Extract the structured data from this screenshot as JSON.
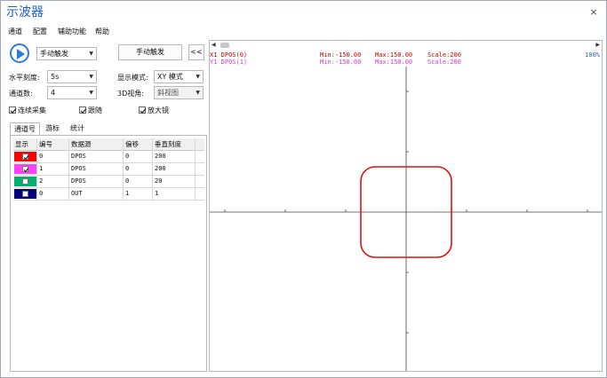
{
  "window": {
    "title": "示波器",
    "close_glyph": "×"
  },
  "menu": {
    "items": [
      "通道",
      "配置",
      "辅助功能",
      "帮助"
    ]
  },
  "controls": {
    "trigger_mode": "手动触发",
    "manual_trigger_button": "手动触发",
    "collapse_button": "<<",
    "horizontal_scale_label": "水平刻度:",
    "horizontal_scale_value": "5s",
    "display_mode_label": "显示模式:",
    "display_mode_value": "XY 模式",
    "channel_count_label": "通道数:",
    "channel_count_value": "4",
    "view_3d_label": "3D视角:",
    "view_3d_value": "斜视图",
    "continuous_label": "连续采集",
    "follow_label": "跟随",
    "magnifier_label": "放大镜"
  },
  "tabs": [
    "通道号",
    "游标",
    "统计"
  ],
  "channel_table": {
    "headers": [
      "显示",
      "编号",
      "数据源",
      "偏移",
      "垂直刻度"
    ],
    "rows": [
      {
        "color": "#ff0000",
        "checked": true,
        "id": "0",
        "source": "DPOS",
        "offset": "0",
        "scale": "200"
      },
      {
        "color": "#ff40ff",
        "checked": true,
        "id": "1",
        "source": "DPOS",
        "offset": "0",
        "scale": "200"
      },
      {
        "color": "#00b070",
        "checked": false,
        "id": "2",
        "source": "DPOS",
        "offset": "0",
        "scale": "20"
      },
      {
        "color": "#000080",
        "checked": false,
        "id": "0",
        "source": "OUT",
        "offset": "1",
        "scale": "1"
      }
    ]
  },
  "scope": {
    "x_info": {
      "name": "X1 DPOS(0)",
      "min": "Min:-150.00",
      "max": "Max:150.00",
      "scale": "Scale:200",
      "color": "#cc0000"
    },
    "y_info": {
      "name": "Y1 DPOS(1)",
      "min": "Min:-150.00",
      "max": "Max:150.00",
      "scale": "Scale:200",
      "color": "#dd33dd"
    },
    "zoom": "100%",
    "zoom_color": "#1f5fbf",
    "trace_color": "#e01010",
    "axis_color": "#444444"
  }
}
